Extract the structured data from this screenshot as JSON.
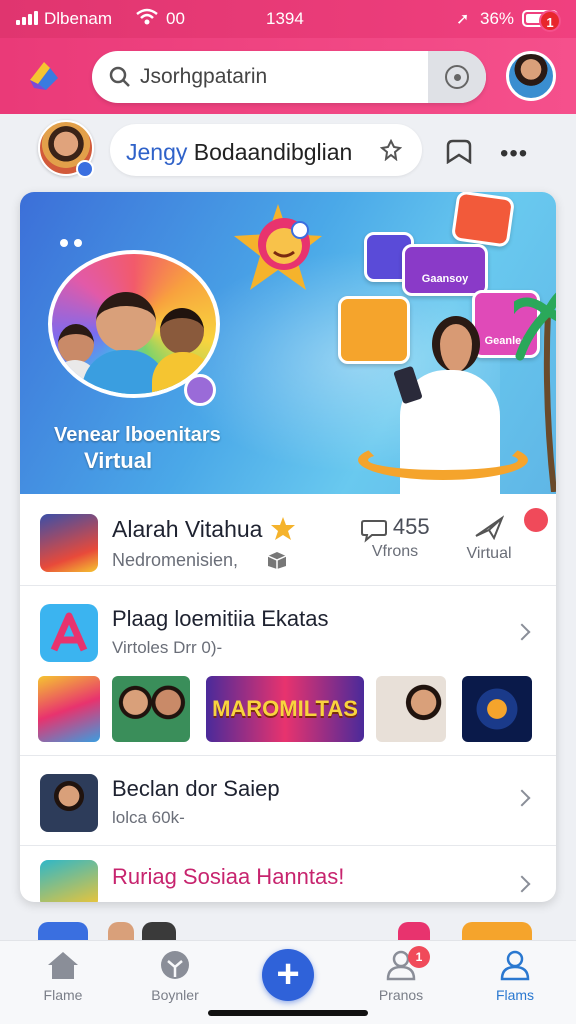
{
  "status_bar": {
    "carrier": "Dlbenam",
    "network": "00",
    "time": "1394",
    "battery_pct": "36%"
  },
  "header": {
    "search": {
      "value": "Jsorhgpatarin"
    },
    "notification_count": "1"
  },
  "subheader": {
    "name_prefix": "Jengy",
    "name_rest": " Bodaandibglian",
    "more_label": "•••"
  },
  "banner": {
    "title_line1": "Venear lboenitars",
    "title_line2": "Virtual",
    "tiles": [
      "Gaansoy",
      "Geanlee"
    ]
  },
  "feed": {
    "row1": {
      "title": "Alarah Vitahua",
      "subtitle": "Nedromenisien,",
      "stat1_value": "455",
      "stat1_label": "Vfrons",
      "stat2_label": "Virtual"
    },
    "row2": {
      "title": "Plaag loemitiia Ekatas",
      "subtitle": "Virtoles Drr 0)-",
      "strip_banner_text": "MAROMILTAS"
    },
    "row3": {
      "title": "Beclan dor Saiep",
      "subtitle": "lolca 60k-"
    },
    "row4": {
      "title": "Ruriag Sosiaa Hanntas!"
    }
  },
  "bottom_nav": {
    "items": [
      {
        "label": "Flame"
      },
      {
        "label": "Boynler"
      },
      {
        "label": "+"
      },
      {
        "label": "Pranos"
      },
      {
        "label": "Flams"
      }
    ],
    "badge": "1"
  },
  "colors": {
    "header_pink": "#f0407f",
    "accent_blue": "#2f62d9",
    "row4_title": "#c7246e"
  }
}
